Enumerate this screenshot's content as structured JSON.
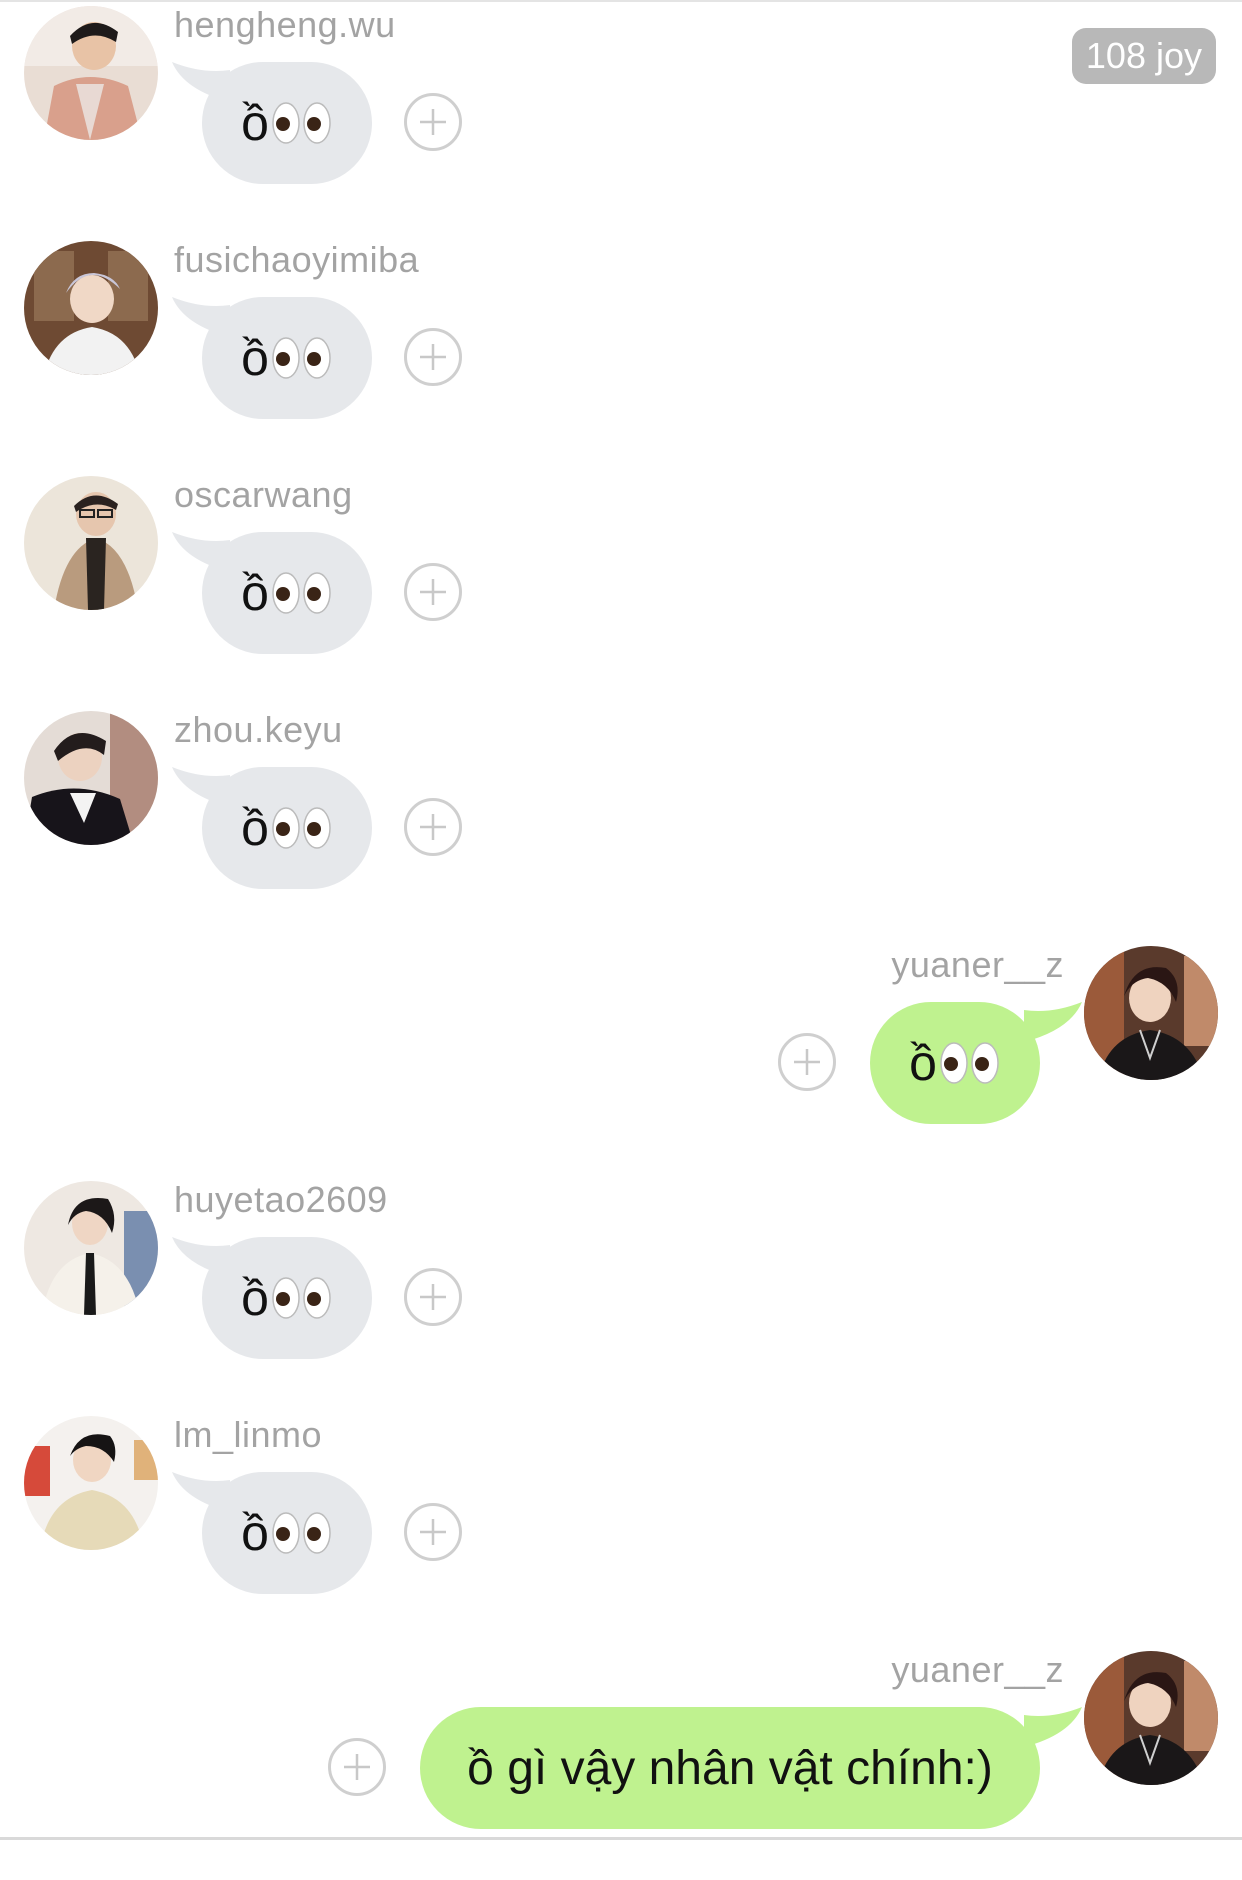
{
  "badge": "108 joy",
  "messages": [
    {
      "user": "hengheng.wu",
      "text": "ồ",
      "emoji": "eyes-emoji",
      "side": "left"
    },
    {
      "user": "fusichaoyimiba",
      "text": "ồ",
      "emoji": "eyes-emoji",
      "side": "left"
    },
    {
      "user": "oscarwang",
      "text": "ồ",
      "emoji": "eyes-emoji",
      "side": "left"
    },
    {
      "user": "zhou.keyu",
      "text": "ồ",
      "emoji": "eyes-emoji",
      "side": "left"
    },
    {
      "user": "yuaner__z",
      "text": "ồ",
      "emoji": "eyes-emoji",
      "side": "right"
    },
    {
      "user": "huyetao2609",
      "text": "ồ",
      "emoji": "eyes-emoji",
      "side": "left"
    },
    {
      "user": "lm_linmo",
      "text": "ồ",
      "emoji": "eyes-emoji",
      "side": "left"
    },
    {
      "user": "yuaner__z",
      "text": "ồ gì vậy nhân vật chính:)",
      "emoji": "",
      "side": "right"
    }
  ],
  "colors": {
    "left_bubble": "#e6e8eb",
    "right_bubble": "#bff28f",
    "username": "#a3a3a3",
    "badge_bg": "#b8b8b8"
  }
}
